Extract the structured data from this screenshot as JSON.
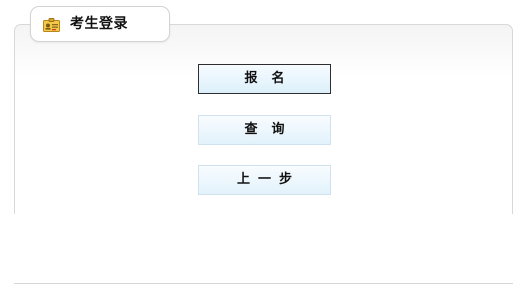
{
  "panel": {
    "title": "考生登录",
    "icon": "id-card-icon"
  },
  "buttons": {
    "register_label": "报名",
    "query_label": "查询",
    "back_label": "上一步"
  },
  "colors": {
    "button_fill": "#e6f4fc",
    "button_border": "#cfe2ee",
    "active_border": "#2e2e2e",
    "panel_border": "#d8d8d8"
  }
}
